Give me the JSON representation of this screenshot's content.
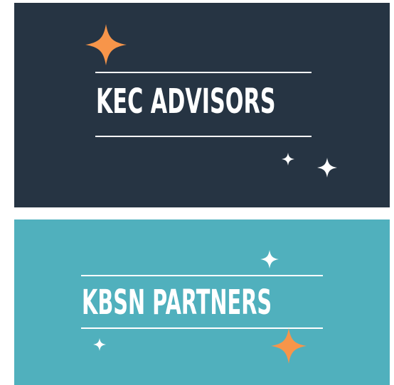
{
  "cards": {
    "top": {
      "title": "KEC ADVISORS",
      "background": "#263443",
      "accent": "#f7954a",
      "icons": [
        "sparkle-icon",
        "sparkle-icon",
        "sparkle-icon"
      ]
    },
    "bottom": {
      "title": "KBSN PARTNERS",
      "background": "#50b0bd",
      "accent": "#f7954a",
      "icons": [
        "sparkle-icon",
        "sparkle-icon",
        "sparkle-icon"
      ]
    }
  },
  "colors": {
    "text": "#ffffff",
    "page": "#ffffff"
  }
}
